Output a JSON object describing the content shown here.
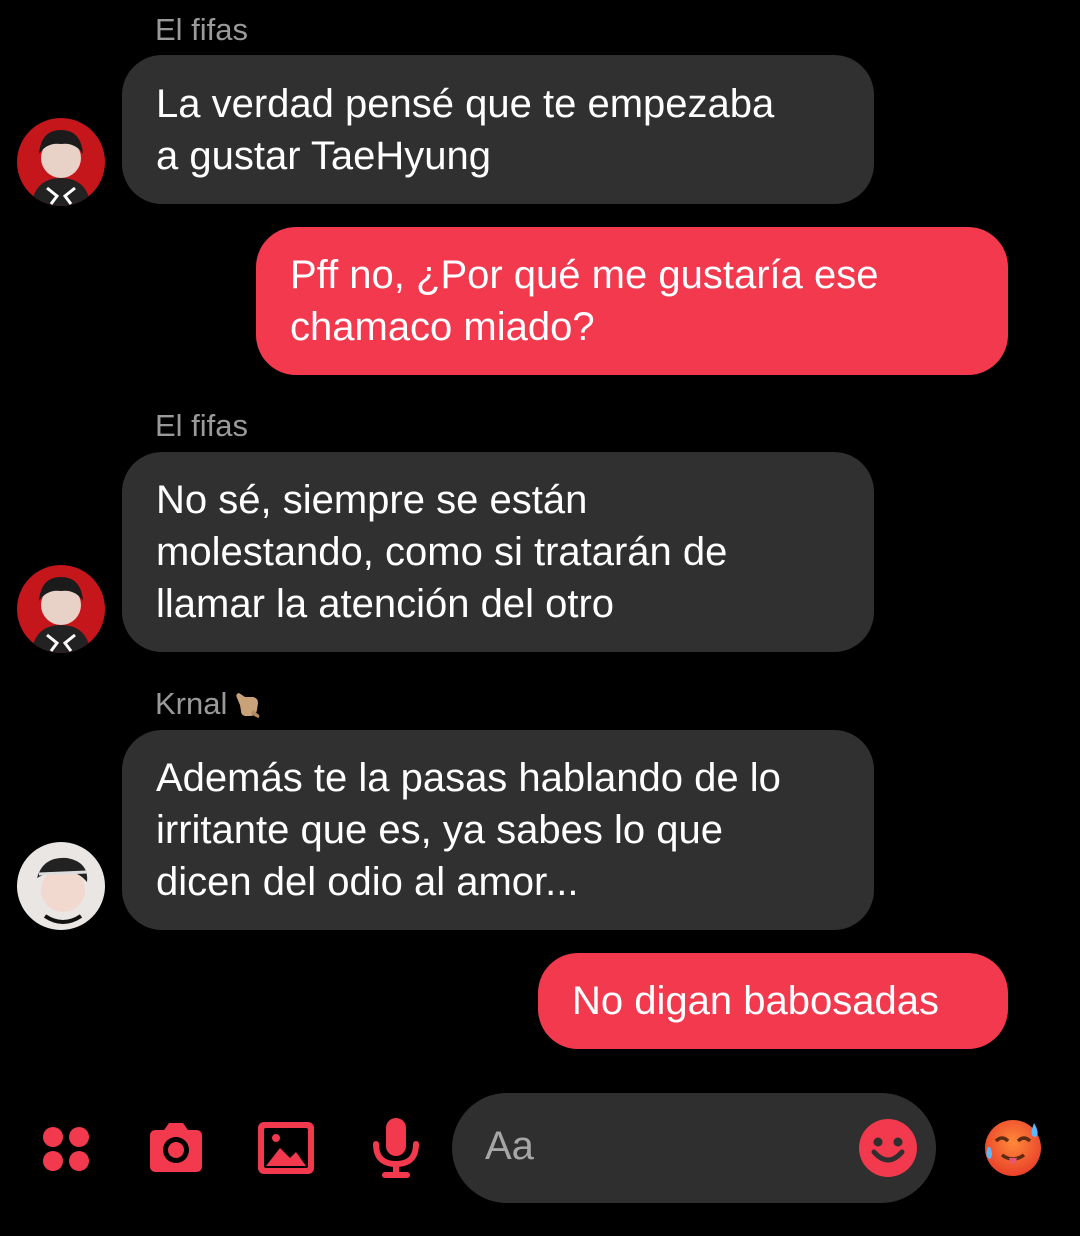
{
  "messages": [
    {
      "sender": "El fifas",
      "text": "La verdad pensé que te empezaba\na gustar TaeHyung",
      "direction": "incoming"
    },
    {
      "text": "Pff no, ¿Por qué me gustaría ese\nchamaco miado?",
      "direction": "outgoing"
    },
    {
      "sender": "El fifas",
      "text": "No sé, siempre se están\nmolestando, como si tratarán de\nllamar la atención del otro",
      "direction": "incoming"
    },
    {
      "sender": "Krnal",
      "sender_emoji": "call-me-hand-icon",
      "text": "Además te la pasas hablando de lo\nirritante que es, ya sabes lo que\ndicen del odio al amor...",
      "direction": "incoming"
    },
    {
      "text": "No digan babosadas",
      "direction": "outgoing"
    }
  ],
  "composer": {
    "placeholder": "Aa",
    "icons": [
      "apps-icon",
      "camera-icon",
      "image-icon",
      "microphone-icon",
      "emoji-smile-icon",
      "hot-face-emoji-icon"
    ]
  },
  "colors": {
    "background": "#000000",
    "incoming_bubble": "#303030",
    "outgoing_bubble": "#f2394d",
    "accent": "#f2394d",
    "sender_name": "#9a9a9a"
  }
}
